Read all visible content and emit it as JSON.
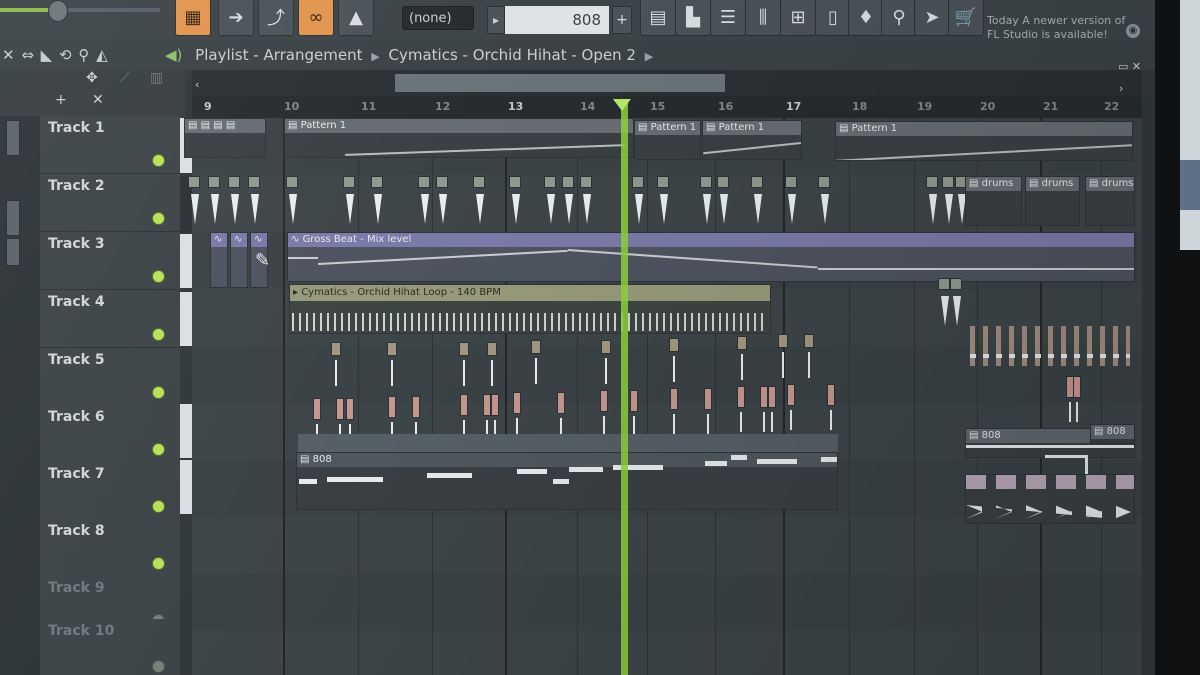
{
  "toolbar": {
    "snap_value": "(none)",
    "pattern_name": "808",
    "news_line1": "Today  A newer version of",
    "news_line2": "FL Studio is available!",
    "icons": [
      "keyboard-icon",
      "arrow-icon",
      "wand-icon",
      "link-icon",
      "hat-icon"
    ]
  },
  "playlist": {
    "title_parts": [
      "Playlist",
      "Arrangement",
      "Cymatics - Orchid Hihat - Open 2"
    ],
    "bar_numbers": [
      "9",
      "10",
      "11",
      "12",
      "13",
      "14",
      "15",
      "16",
      "17",
      "18",
      "19",
      "20",
      "21",
      "22"
    ]
  },
  "tracks": [
    {
      "name": "Track 1"
    },
    {
      "name": "Track 2"
    },
    {
      "name": "Track 3"
    },
    {
      "name": "Track 4"
    },
    {
      "name": "Track 5"
    },
    {
      "name": "Track 6"
    },
    {
      "name": "Track 7"
    },
    {
      "name": "Track 8"
    },
    {
      "name": "Track 9"
    },
    {
      "name": "Track 10"
    }
  ],
  "clips": {
    "pattern1": "Pattern 1",
    "drums": "drums",
    "gross_beat": "Gross Beat - Mix level",
    "hihat_loop": "Cymatics - Orchid Hihat Loop - 140 BPM",
    "p808": "808"
  },
  "colors": {
    "accent_green": "#8fd43a",
    "toolbar_orange": "#e1954e"
  }
}
